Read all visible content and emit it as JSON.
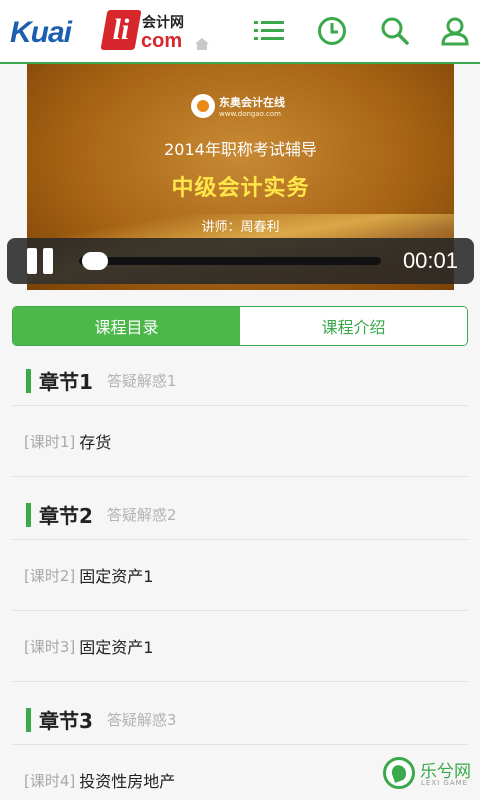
{
  "header": {
    "logo_latin": "Kuai",
    "logo_mark": "li",
    "logo_cn": "会计网",
    "logo_com": "com",
    "icons": [
      "home-icon",
      "menu-icon",
      "history-icon",
      "search-icon",
      "user-icon"
    ],
    "accent_color": "#3aa84b"
  },
  "video": {
    "brand_cn": "东奥会计在线",
    "brand_url": "www.dongao.com",
    "title": "2014年职称考试辅导",
    "subject": "中级会计实务",
    "teacher": "讲师：周春利",
    "time": "00:01",
    "progress_fraction": 0.01
  },
  "tabs": [
    {
      "label": "课程目录",
      "active": true
    },
    {
      "label": "课程介绍",
      "active": false
    }
  ],
  "chapters": [
    {
      "title": "章节1",
      "subtitle": "答疑解惑1",
      "lessons": [
        {
          "tag": "[课时1]",
          "name": "存货"
        }
      ]
    },
    {
      "title": "章节2",
      "subtitle": "答疑解惑2",
      "lessons": [
        {
          "tag": "[课时2]",
          "name": "固定资产1"
        },
        {
          "tag": "[课时3]",
          "name": "固定资产1"
        }
      ]
    },
    {
      "title": "章节3",
      "subtitle": "答疑解惑3",
      "lessons": [
        {
          "tag": "[课时4]",
          "name": "投资性房地产"
        }
      ]
    }
  ],
  "watermark": {
    "text": "乐兮网",
    "sub": "LEXI GAME"
  }
}
